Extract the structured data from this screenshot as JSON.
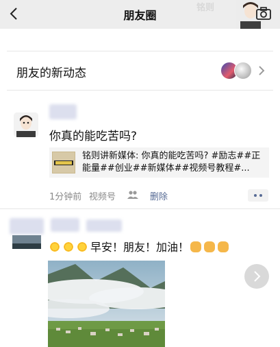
{
  "header": {
    "title": "朋友圈",
    "cover_text": "铭则"
  },
  "news": {
    "label": "朋友的新动态"
  },
  "post1": {
    "text": "你真的能吃苦吗?",
    "share_text": "铭则讲新媒体: 你真的能吃苦吗? #励志##正能量##创业##新媒体##视频号教程#...",
    "time": "1分钟前",
    "source": "视频号",
    "delete_label": "删除"
  },
  "post2": {
    "text": "早安！朋友！加油！"
  },
  "colors": {
    "link": "#576b95",
    "topbar_bg": "#ededed",
    "meta": "#8a8a8a"
  }
}
